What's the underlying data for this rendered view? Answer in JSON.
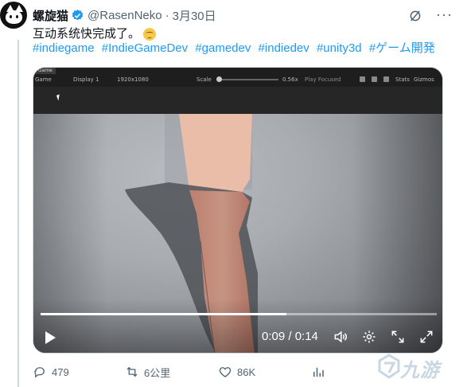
{
  "tweet": {
    "display_name": "螺旋猫",
    "handle": "@RasenNeko",
    "separator": "·",
    "time": "3月30日",
    "text": "互动系统快完成了。",
    "emoji_icon": "relieved-face-emoji",
    "hashtags": [
      "#indiegame",
      "#IndieGameDev",
      "#gamedev",
      "#indiedev",
      "#unity3d",
      "#ゲーム開発"
    ]
  },
  "unity": {
    "tab": "Game",
    "game_dropdown": "Game",
    "display": "Display 1",
    "resolution": "1920x1080",
    "scale_label": "Scale",
    "scale_value": "0.56x",
    "play_focused": "Play Focused",
    "stats": "Stats",
    "gizmos": "Gizmos"
  },
  "video": {
    "time": "0:09 / 0:14",
    "progress": 0.62
  },
  "actions": {
    "replies": "479",
    "retweets": "6公里",
    "likes": "86K"
  },
  "watermark": {
    "text": "九游"
  },
  "colors": {
    "accent": "#1d9bf0",
    "muted": "#536471"
  }
}
